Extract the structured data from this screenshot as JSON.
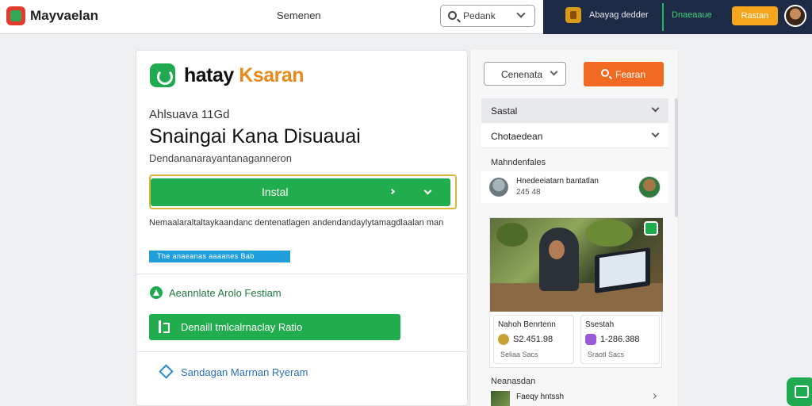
{
  "topbar": {
    "brand": "Mayvaelan",
    "center_label": "Semenen",
    "search_placeholder": "Pedank",
    "dark_panel": {
      "label1": "Abayag dedder",
      "label2": "Dnaeaaue",
      "button": "Rastan",
      "accent_color": "#1fb864"
    }
  },
  "app": {
    "title_main": "hatay ",
    "title_accent": "Ksaran",
    "subtitle_small": "Ahlsuava 11Gd",
    "heading": "Snaingai Kana Disuauai",
    "description": "Dendananarayantanaganneron",
    "install_label": "Instal",
    "info_text": "Nemaalaraltaltaykaandanc dentenatlagen andendandaylytamagdlaalan man",
    "info_link": "The anaeanas aaaanes  Bab",
    "feature_label": "Aeannlate Arolo Festiam",
    "feature_button": "Denaill tmlcalrnaclay Ratio",
    "link_label": "Sandagan Marrnan Ryeram"
  },
  "sidebar": {
    "category_select": "Cenenata",
    "search_button": "Fearan",
    "accordion": [
      {
        "label": "Sastal"
      },
      {
        "label": "Chotaedean"
      }
    ],
    "members": {
      "title": "Mahndenfales",
      "name": "Hnedeeiatarn bantatlan",
      "count": "245 48"
    },
    "stats": [
      {
        "title": "Nahoh Benrtenn",
        "value": "S2.451.98",
        "sub": "Seliaa Sacs"
      },
      {
        "title": "Ssestah",
        "value": "1-286.388",
        "sub": "Sraotl Sacs"
      }
    ],
    "footer": {
      "title": "Neanasdan",
      "item": "Faeqy hntssh"
    }
  },
  "colors": {
    "brand_green": "#21ac4d",
    "accent_orange": "#f26a22",
    "accent_yellow": "#f4a51c",
    "link_blue": "#1e9fdc",
    "dark_navy": "#1e2b47"
  }
}
